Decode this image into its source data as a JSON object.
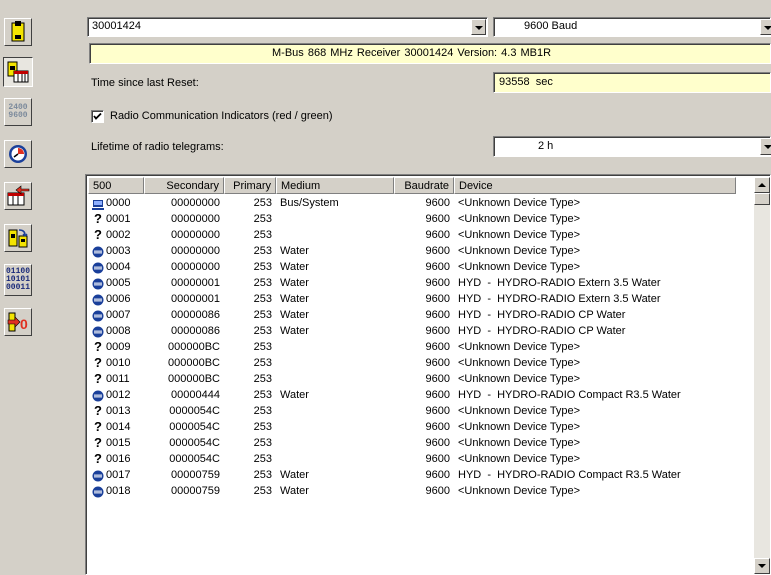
{
  "toolbar": {
    "buttons": [
      {
        "name": "device-icon",
        "label": ""
      },
      {
        "name": "read-list-icon",
        "label": ""
      },
      {
        "name": "baud-icon",
        "label_top": "2400",
        "label_bottom": "9600"
      },
      {
        "name": "clock-icon",
        "label": ""
      },
      {
        "name": "import-icon",
        "label": ""
      },
      {
        "name": "refresh-device-icon",
        "label": ""
      },
      {
        "name": "binary-icon",
        "label_1": "01100",
        "label_2": "10101",
        "label_3": "00011"
      },
      {
        "name": "reset-icon",
        "label": "0"
      }
    ]
  },
  "top": {
    "device_id": "30001424",
    "baud": "9600 Baud",
    "receiver_info": "M-Bus 868 MHz Receiver  30001424  Version: 4.3  MB1R",
    "time_label": "Time since last Reset:",
    "time_value": "93558  sec",
    "radio_indicators_label": "Radio Communication Indicators (red / green)",
    "radio_indicators_checked": true,
    "lifetime_label": "Lifetime of radio telegrams:",
    "lifetime_value": "2 h"
  },
  "list": {
    "columns": [
      "500",
      "Secondary",
      "Primary",
      "Medium",
      "Baudrate",
      "Device"
    ],
    "rows": [
      {
        "icon": "bus",
        "no": "0000",
        "secondary": "00000000",
        "primary": "253",
        "medium": "Bus/System",
        "baud": "9600",
        "device": "<Unknown Device Type>"
      },
      {
        "icon": "q",
        "no": "0001",
        "secondary": "00000000",
        "primary": "253",
        "medium": "",
        "baud": "9600",
        "device": "<Unknown Device Type>"
      },
      {
        "icon": "q",
        "no": "0002",
        "secondary": "00000000",
        "primary": "253",
        "medium": "",
        "baud": "9600",
        "device": "<Unknown Device Type>"
      },
      {
        "icon": "radio",
        "no": "0003",
        "secondary": "00000000",
        "primary": "253",
        "medium": "Water",
        "baud": "9600",
        "device": "<Unknown Device Type>"
      },
      {
        "icon": "radio",
        "no": "0004",
        "secondary": "00000000",
        "primary": "253",
        "medium": "Water",
        "baud": "9600",
        "device": "<Unknown Device Type>"
      },
      {
        "icon": "radio",
        "no": "0005",
        "secondary": "00000001",
        "primary": "253",
        "medium": "Water",
        "baud": "9600",
        "device": "HYD  -  HYDRO-RADIO Extern 3.5 Water"
      },
      {
        "icon": "radio",
        "no": "0006",
        "secondary": "00000001",
        "primary": "253",
        "medium": "Water",
        "baud": "9600",
        "device": "HYD  -  HYDRO-RADIO Extern 3.5 Water"
      },
      {
        "icon": "radio",
        "no": "0007",
        "secondary": "00000086",
        "primary": "253",
        "medium": "Water",
        "baud": "9600",
        "device": "HYD  -  HYDRO-RADIO CP Water"
      },
      {
        "icon": "radio",
        "no": "0008",
        "secondary": "00000086",
        "primary": "253",
        "medium": "Water",
        "baud": "9600",
        "device": "HYD  -  HYDRO-RADIO CP Water"
      },
      {
        "icon": "q",
        "no": "0009",
        "secondary": "000000BC",
        "primary": "253",
        "medium": "",
        "baud": "9600",
        "device": "<Unknown Device Type>"
      },
      {
        "icon": "q",
        "no": "0010",
        "secondary": "000000BC",
        "primary": "253",
        "medium": "",
        "baud": "9600",
        "device": "<Unknown Device Type>"
      },
      {
        "icon": "q",
        "no": "0011",
        "secondary": "000000BC",
        "primary": "253",
        "medium": "",
        "baud": "9600",
        "device": "<Unknown Device Type>"
      },
      {
        "icon": "radio",
        "no": "0012",
        "secondary": "00000444",
        "primary": "253",
        "medium": "Water",
        "baud": "9600",
        "device": "HYD  -  HYDRO-RADIO Compact R3.5 Water"
      },
      {
        "icon": "q",
        "no": "0013",
        "secondary": "0000054C",
        "primary": "253",
        "medium": "",
        "baud": "9600",
        "device": "<Unknown Device Type>"
      },
      {
        "icon": "q",
        "no": "0014",
        "secondary": "0000054C",
        "primary": "253",
        "medium": "",
        "baud": "9600",
        "device": "<Unknown Device Type>"
      },
      {
        "icon": "q",
        "no": "0015",
        "secondary": "0000054C",
        "primary": "253",
        "medium": "",
        "baud": "9600",
        "device": "<Unknown Device Type>"
      },
      {
        "icon": "q",
        "no": "0016",
        "secondary": "0000054C",
        "primary": "253",
        "medium": "",
        "baud": "9600",
        "device": "<Unknown Device Type>"
      },
      {
        "icon": "radio",
        "no": "0017",
        "secondary": "00000759",
        "primary": "253",
        "medium": "Water",
        "baud": "9600",
        "device": "HYD  -  HYDRO-RADIO Compact R3.5 Water"
      },
      {
        "icon": "radio",
        "no": "0018",
        "secondary": "00000759",
        "primary": "253",
        "medium": "Water",
        "baud": "9600",
        "device": "<Unknown Device Type>"
      }
    ]
  },
  "colors": {
    "face": "#d4d0c8",
    "info_yellow": "#ffffcc",
    "icon_blue": "#1a3f9a",
    "icon_red": "#e03020"
  }
}
